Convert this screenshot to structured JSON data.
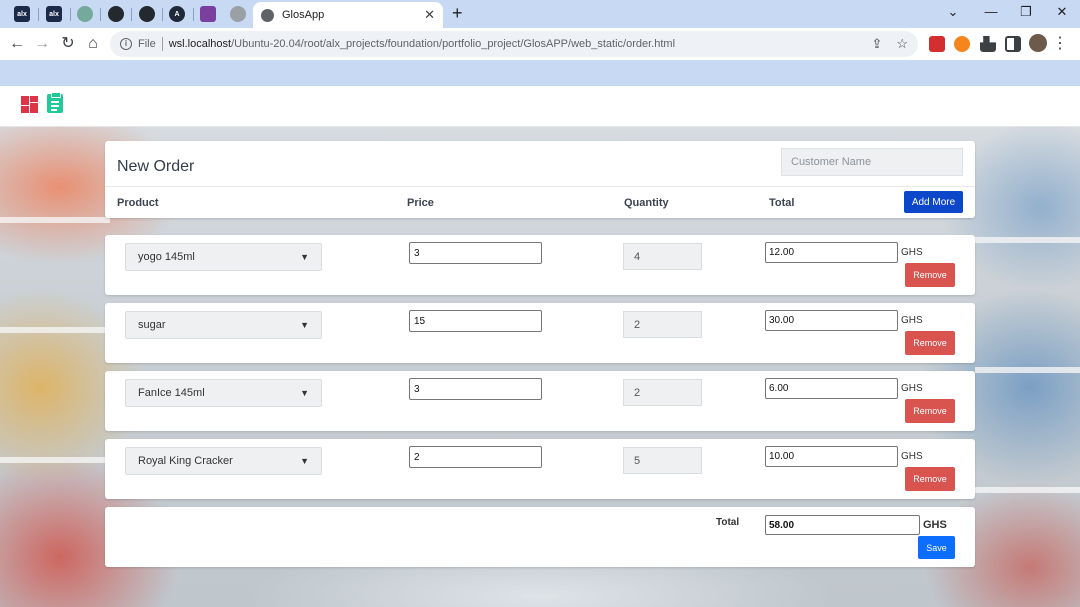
{
  "browser": {
    "pinned_tabs": [
      {
        "icon": "alx-icon",
        "text": "alx",
        "color": "#1c2a4a"
      },
      {
        "icon": "alx-icon",
        "text": "alx",
        "color": "#1c2a4a"
      },
      {
        "icon": "chatgpt-icon",
        "text": "",
        "color": "#74aa9c"
      },
      {
        "icon": "github-icon",
        "text": "",
        "color": "#24292f"
      },
      {
        "icon": "github-icon",
        "text": "",
        "color": "#24292f"
      },
      {
        "icon": "arch-icon",
        "text": "A",
        "color": "#1f2937"
      },
      {
        "icon": "site-icon",
        "text": "",
        "color": "#7b3fa0"
      },
      {
        "icon": "globe-icon",
        "text": "",
        "color": "#9aa0a6"
      }
    ],
    "active_tab_title": "GlosApp",
    "url_scheme": "File",
    "url_host": "wsl.localhost",
    "url_path": "/Ubuntu-20.04/root/alx_projects/foundation/portfolio_project/GlosAPP/web_static/order.html",
    "colors": {
      "tabstrip": "#c8d9f3"
    }
  },
  "app": {
    "title": "New Order",
    "customer_placeholder": "Customer Name",
    "columns": {
      "product": "Product",
      "price": "Price",
      "quantity": "Quantity",
      "total": "Total"
    },
    "add_more_label": "Add More",
    "rows": [
      {
        "product": "yogo 145ml",
        "price": "3",
        "quantity": "4",
        "total": "12.00",
        "currency": "GHS",
        "remove_label": "Remove"
      },
      {
        "product": "sugar",
        "price": "15",
        "quantity": "2",
        "total": "30.00",
        "currency": "GHS",
        "remove_label": "Remove"
      },
      {
        "product": "FanIce 145ml",
        "price": "3",
        "quantity": "2",
        "total": "6.00",
        "currency": "GHS",
        "remove_label": "Remove"
      },
      {
        "product": "Royal King Cracker",
        "price": "2",
        "quantity": "5",
        "total": "10.00",
        "currency": "GHS",
        "remove_label": "Remove"
      }
    ],
    "grand_total_label": "Total",
    "grand_total": "58.00",
    "grand_currency": "GHS",
    "save_label": "Save",
    "colors": {
      "primary": "#0d47c9",
      "danger": "#d9534f",
      "save": "#0d6efd"
    }
  }
}
